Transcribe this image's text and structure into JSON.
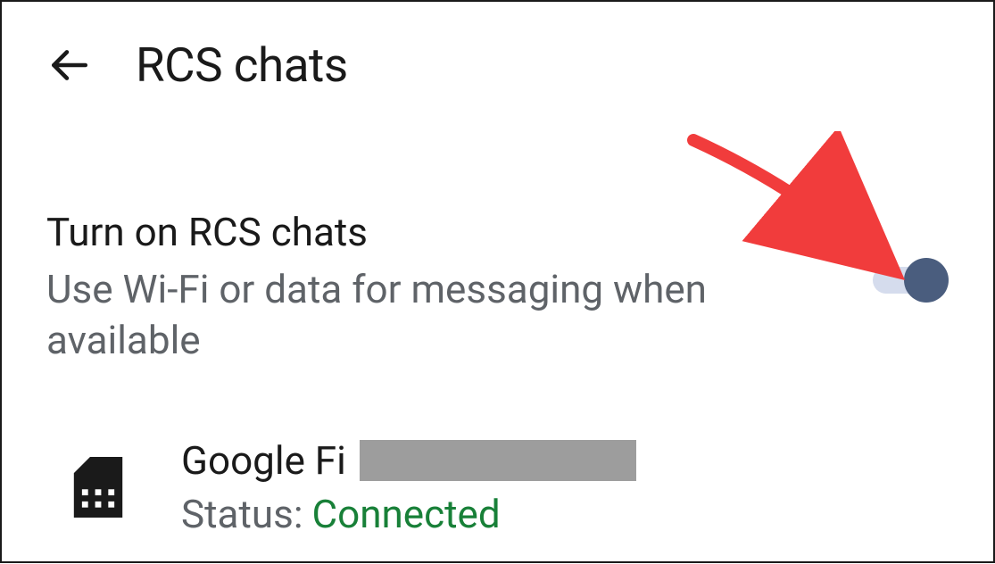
{
  "header": {
    "title": "RCS chats"
  },
  "setting": {
    "title": "Turn on RCS chats",
    "subtitle": "Use Wi-Fi or data for messaging when available",
    "toggle_on": true
  },
  "sim": {
    "carrier": "Google Fi",
    "status_label": "Status:",
    "status_value": "Connected"
  }
}
